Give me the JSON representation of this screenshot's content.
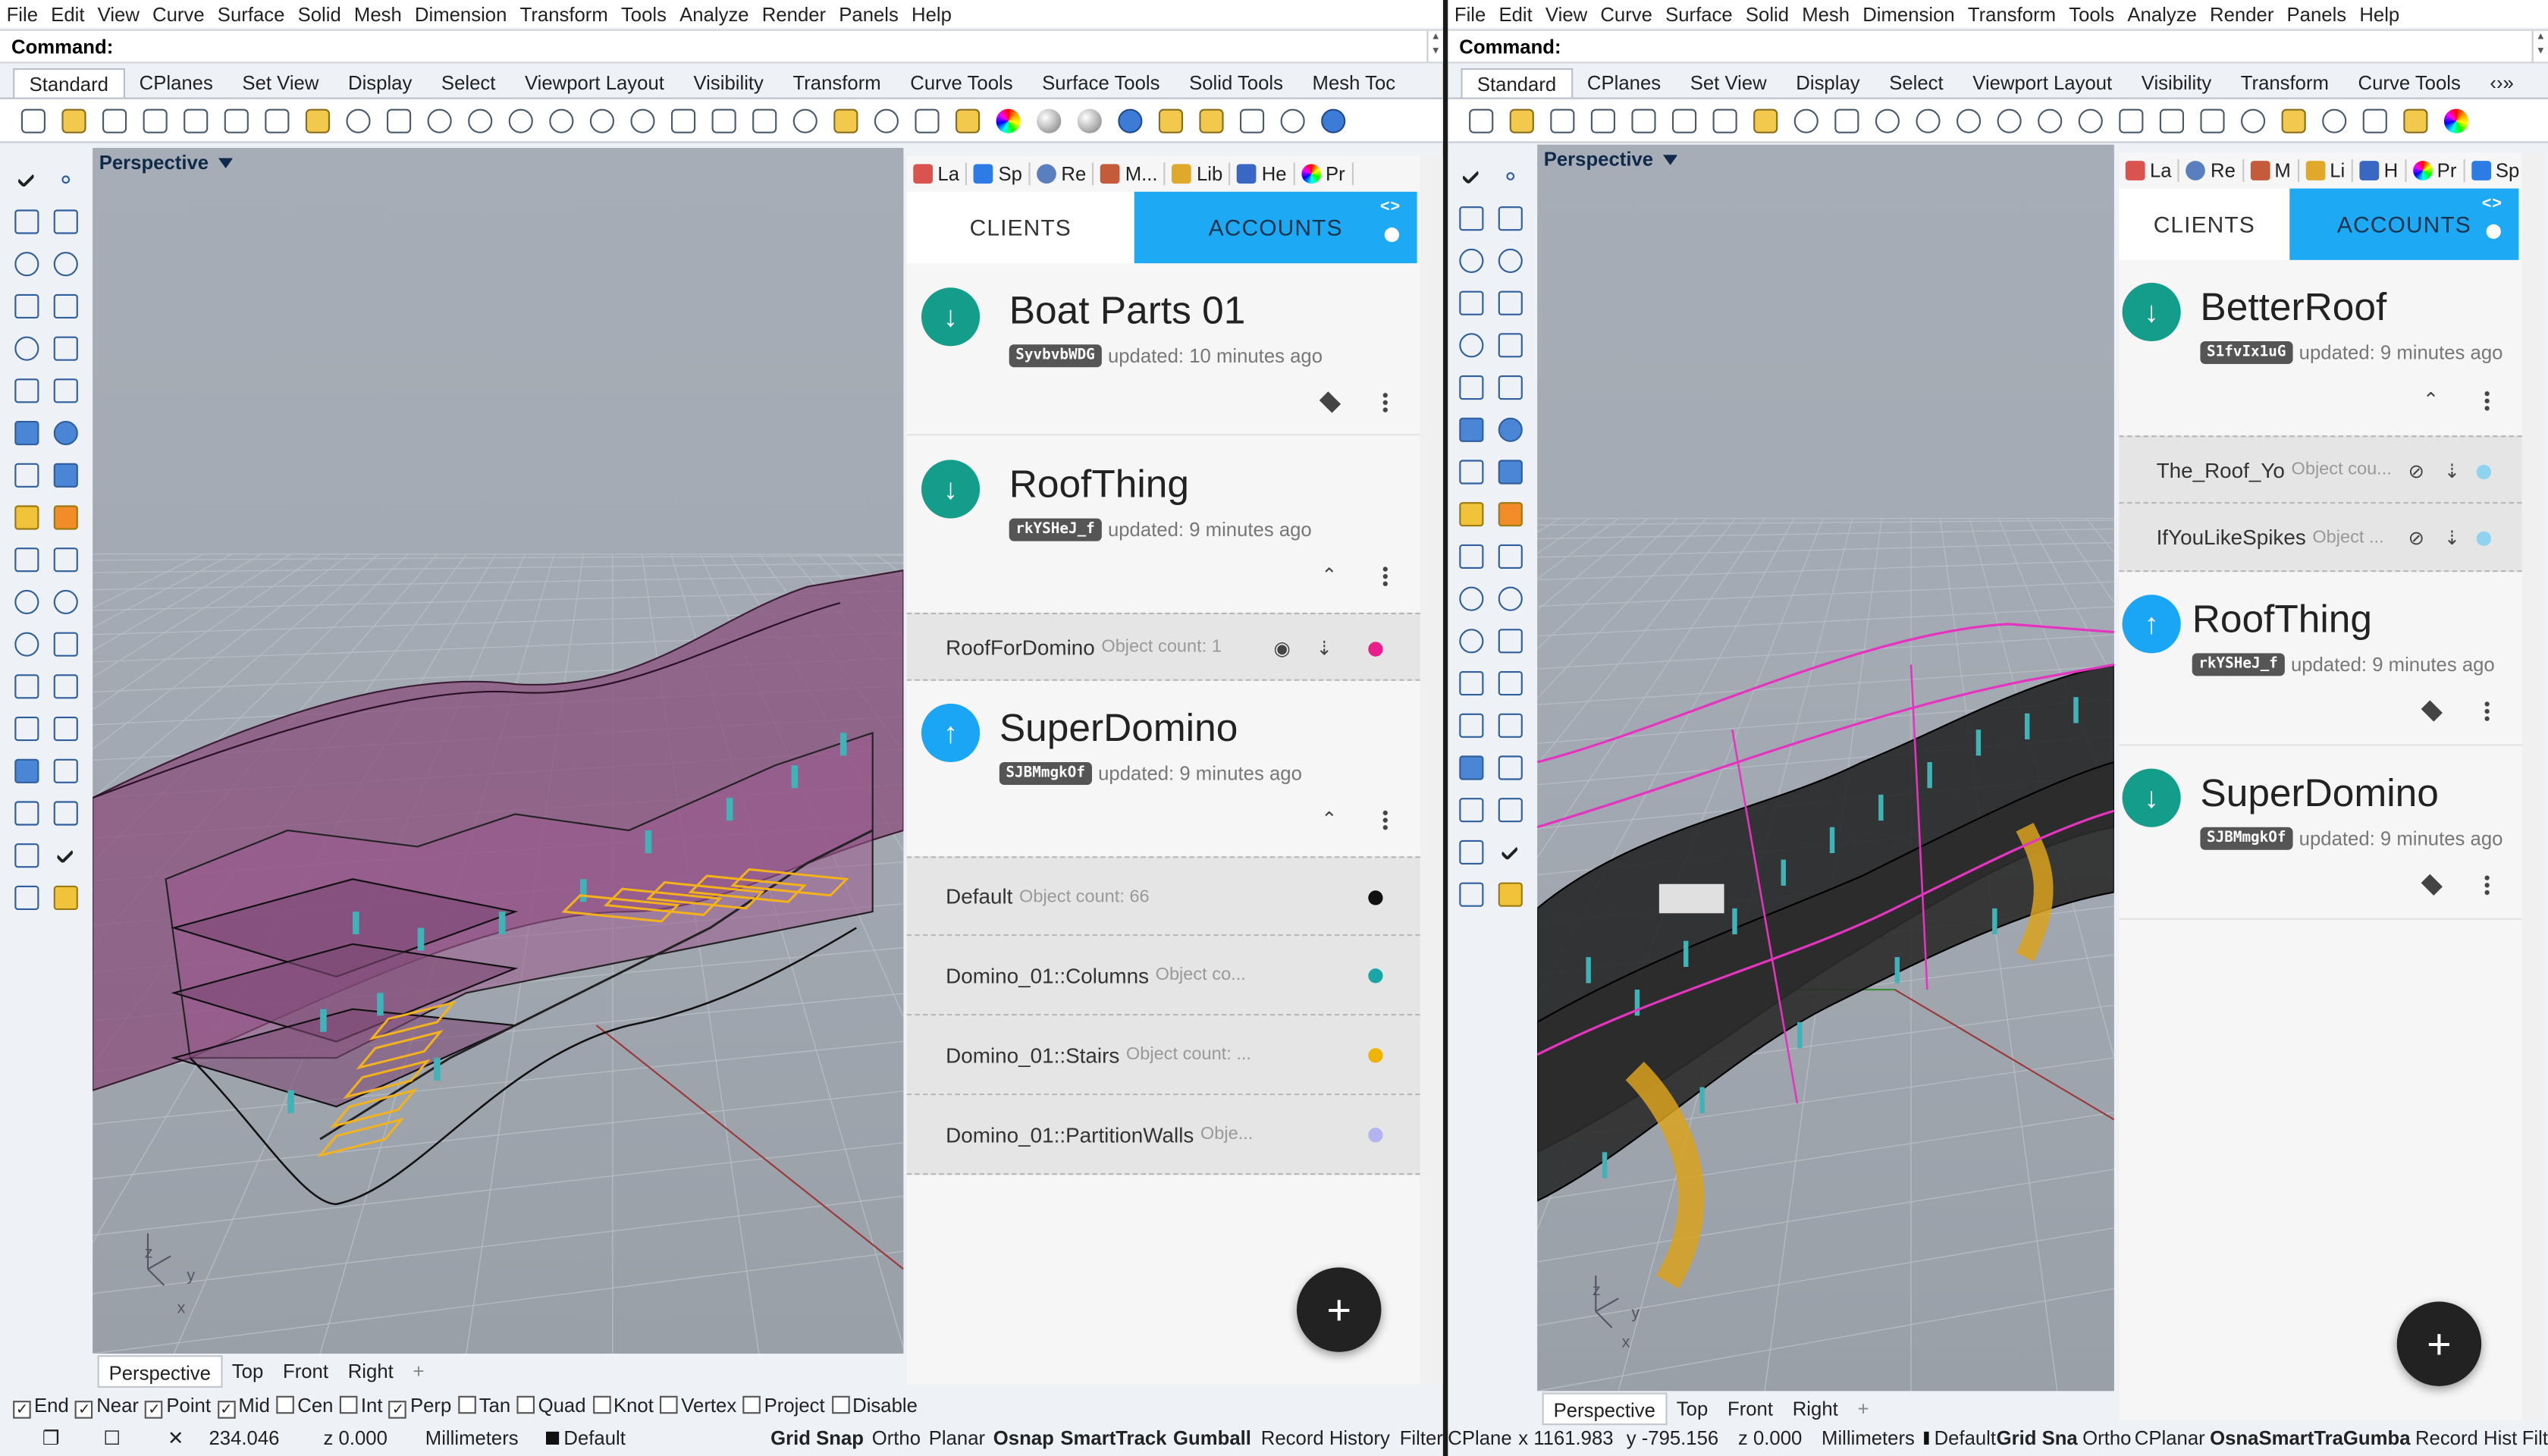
{
  "menu": [
    "File",
    "Edit",
    "View",
    "Curve",
    "Surface",
    "Solid",
    "Mesh",
    "Dimension",
    "Transform",
    "Tools",
    "Analyze",
    "Render",
    "Panels",
    "Help"
  ],
  "command_label": "Command:",
  "toolbar_tabs_left": [
    "Standard",
    "CPlanes",
    "Set View",
    "Display",
    "Select",
    "Viewport Layout",
    "Visibility",
    "Transform",
    "Curve Tools",
    "Surface Tools",
    "Solid Tools",
    "Mesh Toc"
  ],
  "toolbar_tabs_right": [
    "Standard",
    "CPlanes",
    "Set View",
    "Display",
    "Select",
    "Viewport Layout",
    "Visibility",
    "Transform",
    "Curve Tools",
    "‹›»"
  ],
  "viewport_label": "Perspective",
  "viewport_tabs": [
    "Perspective",
    "Top",
    "Front",
    "Right"
  ],
  "osnap": [
    "End",
    "Near",
    "Point",
    "Mid",
    "Cen",
    "Int",
    "Perp",
    "Tan",
    "Quad",
    "Knot",
    "Vertex",
    "Project",
    "Disable"
  ],
  "osnap_checked": [
    true,
    true,
    true,
    true,
    false,
    false,
    true,
    false,
    false,
    false,
    false,
    false,
    false
  ],
  "status_left": {
    "coords": "234.046",
    "z": "z 0.000",
    "units": "Millimeters",
    "layer": "Default",
    "grid": "Grid Snap",
    "ortho": "Ortho",
    "planar": "Planar",
    "osnap": "Osnap",
    "smarttrack": "SmartTrack",
    "gumball": "Gumball",
    "record": "Record History",
    "filter": "Filter"
  },
  "status_right": {
    "cplane": "CPlane",
    "x": "x 1161.983",
    "y": "y -795.156",
    "z": "z 0.000",
    "units": "Millimeters",
    "layer": "Default",
    "grid": "Grid Sna",
    "ortho": "Ortho",
    "planar": "CPlanar",
    "osnap": "Osna",
    "smarttrack": "SmartTra",
    "gumball": "Gumba",
    "record": "Record Hist",
    "filter": "Filt"
  },
  "panel_tabs_left": [
    "La",
    "Sp",
    "Re",
    "M...",
    "Lib",
    "He",
    "Pr"
  ],
  "panel_tabs_right": [
    "La",
    "Re",
    "M",
    "Li",
    "H",
    "Pr",
    "Sp"
  ],
  "tabs_header": {
    "clients": "CLIENTS",
    "accounts": "ACCOUNTS",
    "code_icon": "<>"
  },
  "left_panel": {
    "clients": [
      {
        "name": "Boat Parts 01",
        "id": "SyvbvbWDG",
        "updated": "updated: 10 minutes ago",
        "type": "receiver"
      },
      {
        "name": "RoofThing",
        "id": "rkYSHeJ_f",
        "updated": "updated: 9 minutes ago",
        "type": "receiver",
        "streams": [
          {
            "name": "RoofForDomino",
            "count": "Object count: 1",
            "color": "#e91e8c"
          }
        ]
      },
      {
        "name": "SuperDomino",
        "id": "SJBMmgkOf",
        "updated": "updated: 9 minutes ago",
        "type": "sender",
        "streams": [
          {
            "name": "Default",
            "count": "Object count: 66",
            "color": "#111111"
          },
          {
            "name": "Domino_01::Columns",
            "count": "Object co...",
            "color": "#1aa6a6"
          },
          {
            "name": "Domino_01::Stairs",
            "count": "Object count: ...",
            "color": "#f0b400"
          },
          {
            "name": "Domino_01::PartitionWalls",
            "count": "Obje...",
            "color": "#b3b3ef"
          }
        ]
      }
    ]
  },
  "right_panel": {
    "clients": [
      {
        "name": "BetterRoof",
        "id": "S1fvIx1uG",
        "updated": "updated: 9 minutes ago",
        "type": "receiver",
        "streams": [
          {
            "name": "The_Roof_Yo",
            "count": "Object cou...",
            "color": "#8fd3ef"
          },
          {
            "name": "IfYouLikeSpikes",
            "count": "Object ...",
            "color": "#8fd3ef"
          }
        ]
      },
      {
        "name": "RoofThing",
        "id": "rkYSHeJ_f",
        "updated": "updated: 9 minutes ago",
        "type": "sender"
      },
      {
        "name": "SuperDomino",
        "id": "SJBMmgkOf",
        "updated": "updated: 9 minutes ago",
        "type": "receiver"
      }
    ]
  },
  "fab_label": "+",
  "axis_labels": {
    "z": "z",
    "y": "y",
    "x": "x"
  }
}
